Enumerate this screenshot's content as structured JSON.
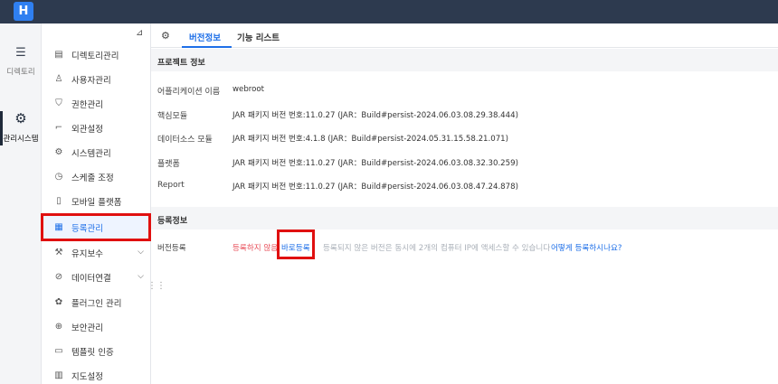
{
  "app": {
    "logo_glyph": "H"
  },
  "rail": [
    {
      "label": "디렉토리",
      "icon": "list-icon"
    },
    {
      "label": "관리시스템",
      "icon": "gear-icon"
    }
  ],
  "menu": {
    "items": [
      {
        "label": "디렉토리관리",
        "icon": "directory-icon"
      },
      {
        "label": "사용자관리",
        "icon": "user-icon"
      },
      {
        "label": "권한관리",
        "icon": "shield-icon"
      },
      {
        "label": "외관설정",
        "icon": "brush-icon"
      },
      {
        "label": "시스템관리",
        "icon": "gear-icon"
      },
      {
        "label": "스케줄 조정",
        "icon": "clock-icon"
      },
      {
        "label": "모바일 플랫폼",
        "icon": "mobile-icon"
      },
      {
        "label": "등록관리",
        "icon": "register-icon",
        "active": true
      },
      {
        "label": "유지보수",
        "icon": "maintenance-icon",
        "expandable": true
      },
      {
        "label": "데이터연결",
        "icon": "link-icon",
        "expandable": true
      },
      {
        "label": "플러그인 관리",
        "icon": "plugin-icon"
      },
      {
        "label": "보안관리",
        "icon": "security-icon"
      },
      {
        "label": "템플릿 인증",
        "icon": "template-icon"
      },
      {
        "label": "지도설정",
        "icon": "map-icon"
      }
    ]
  },
  "tabs": [
    {
      "label": "버전정보",
      "active": true
    },
    {
      "label": "기능 리스트"
    }
  ],
  "project_info": {
    "title": "프로젝트 정보",
    "rows": [
      {
        "key": "어플리케이션 이름",
        "value": "webroot"
      },
      {
        "key": "핵심모듈",
        "value": "JAR 패키지 버전 번호:11.0.27  (JAR：Build#persist-2024.06.03.08.29.38.444)"
      },
      {
        "key": "데이터소스 모듈",
        "value": "JAR 패키지 버전 번호:4.1.8  (JAR：Build#persist-2024.05.31.15.58.21.071)"
      },
      {
        "key": "플랫폼",
        "value": "JAR 패키지 버전 번호:11.0.27  (JAR：Build#persist-2024.06.03.08.32.30.259)"
      },
      {
        "key": "Report",
        "value": "JAR 패키지 버전 번호:11.0.27  (JAR：Build#persist-2024.06.03.08.47.24.878)"
      }
    ]
  },
  "registration": {
    "title": "등록정보",
    "key": "버전등록",
    "status": "등록하지 않음",
    "quick_register": "바로등록",
    "note": "등록되지 않은 버전은 동시에 2개의 컴퓨터 IP에 액세스할 수 있습니다",
    "how_link": "어떻게 등록하시나요?"
  },
  "colors": {
    "accent": "#1e6fe8",
    "topbar": "#2d3a4f",
    "warning": "#e8505b",
    "highlight": "#e01010"
  }
}
